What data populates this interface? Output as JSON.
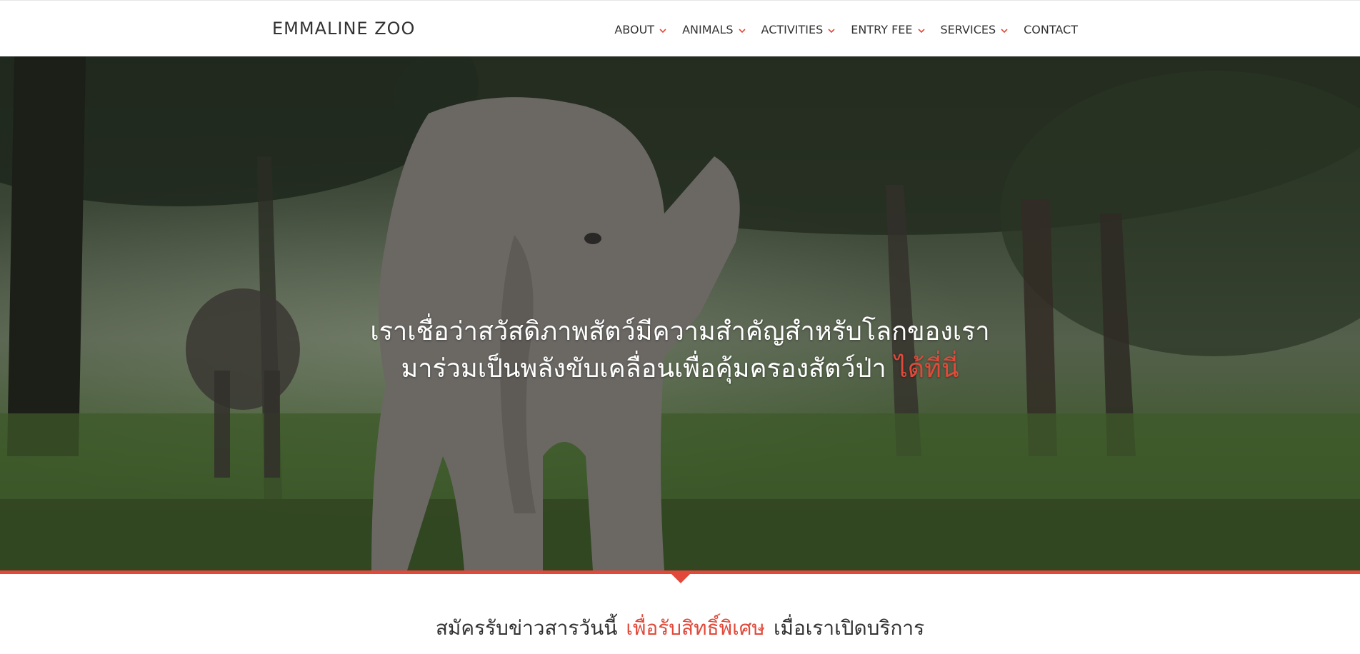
{
  "header": {
    "brand": "EMMALINE ZOO",
    "menu": [
      {
        "label": "ABOUT",
        "has_dropdown": true
      },
      {
        "label": "ANIMALS",
        "has_dropdown": true
      },
      {
        "label": "ACTIVITIES",
        "has_dropdown": true
      },
      {
        "label": "ENTRY FEE",
        "has_dropdown": true
      },
      {
        "label": "SERVICES",
        "has_dropdown": true
      },
      {
        "label": "CONTACT",
        "has_dropdown": false
      }
    ]
  },
  "hero": {
    "line1": "เราเชื่อว่าสวัสดิภาพสัตว์มีความสำคัญสำหรับโลกของเรา",
    "line2": "มาร่วมเป็นพลังขับเคลื่อนเพื่อคุ้มครองสัตว์ป่า",
    "link": "ได้ที่นี่",
    "image": "elephant-in-forest"
  },
  "subscribe": {
    "before": "สมัครรับข่าวสารวันนี้",
    "accent": "เพื่อรับสิทธิ์พิเศษ",
    "after": "เมื่อเราเปิดบริการ"
  },
  "colors": {
    "accent": "#e2493a",
    "text": "#333333",
    "nav_bg": "#ffffff"
  }
}
